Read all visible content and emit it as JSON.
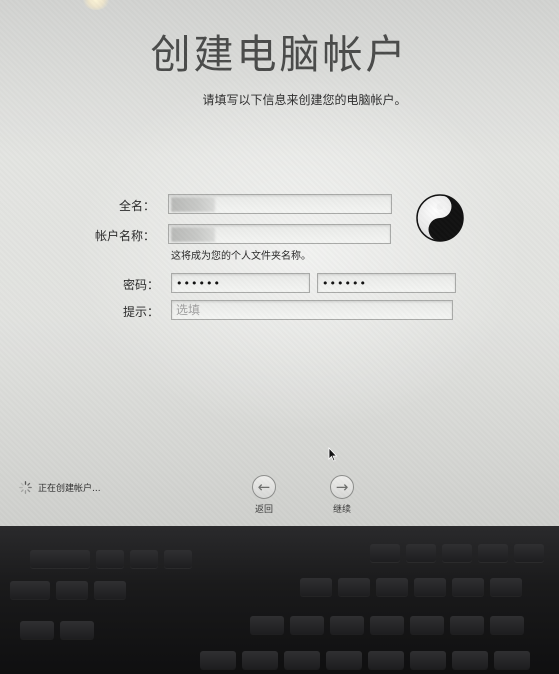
{
  "window": {
    "title": "创建电脑帐户",
    "subtitle": "请填写以下信息来创建您的电脑帐户。"
  },
  "form": {
    "full_name": {
      "label": "全名：",
      "value": ""
    },
    "account_name": {
      "label": "帐户名称：",
      "value": "",
      "hint": "这将成为您的个人文件夹名称。"
    },
    "password": {
      "label": "密码：",
      "value": "••••••",
      "verify_value": "••••••"
    },
    "password_hint": {
      "label": "提示：",
      "placeholder": "选填"
    }
  },
  "avatar": {
    "icon": "yin-yang-icon"
  },
  "footer": {
    "status_text": "正在创建帐户...",
    "back_label": "返回",
    "continue_label": "继续"
  }
}
